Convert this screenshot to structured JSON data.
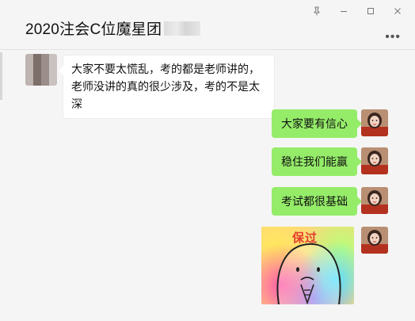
{
  "window": {
    "title": "2020注会C位魔星团"
  },
  "messages": [
    {
      "from": "other",
      "text": "大家不要太慌乱，考的都是老师讲的，老师没讲的真的很少涉及，考的不是太深"
    },
    {
      "from": "me",
      "text": "大家要有信心"
    },
    {
      "from": "me",
      "text": "稳住我们能赢"
    },
    {
      "from": "me",
      "text": "考试都很基础"
    },
    {
      "from": "me",
      "type": "sticker",
      "text": "保过"
    }
  ],
  "icons": {
    "pin": "pin-icon",
    "minimize": "minimize-icon",
    "maximize": "maximize-icon",
    "close": "close-icon",
    "more": "more-icon"
  },
  "colors": {
    "outgoing_bubble": "#95ec69",
    "incoming_bubble": "#ffffff",
    "background": "#f5f5f5",
    "sticker_text": "#e23b2e"
  }
}
